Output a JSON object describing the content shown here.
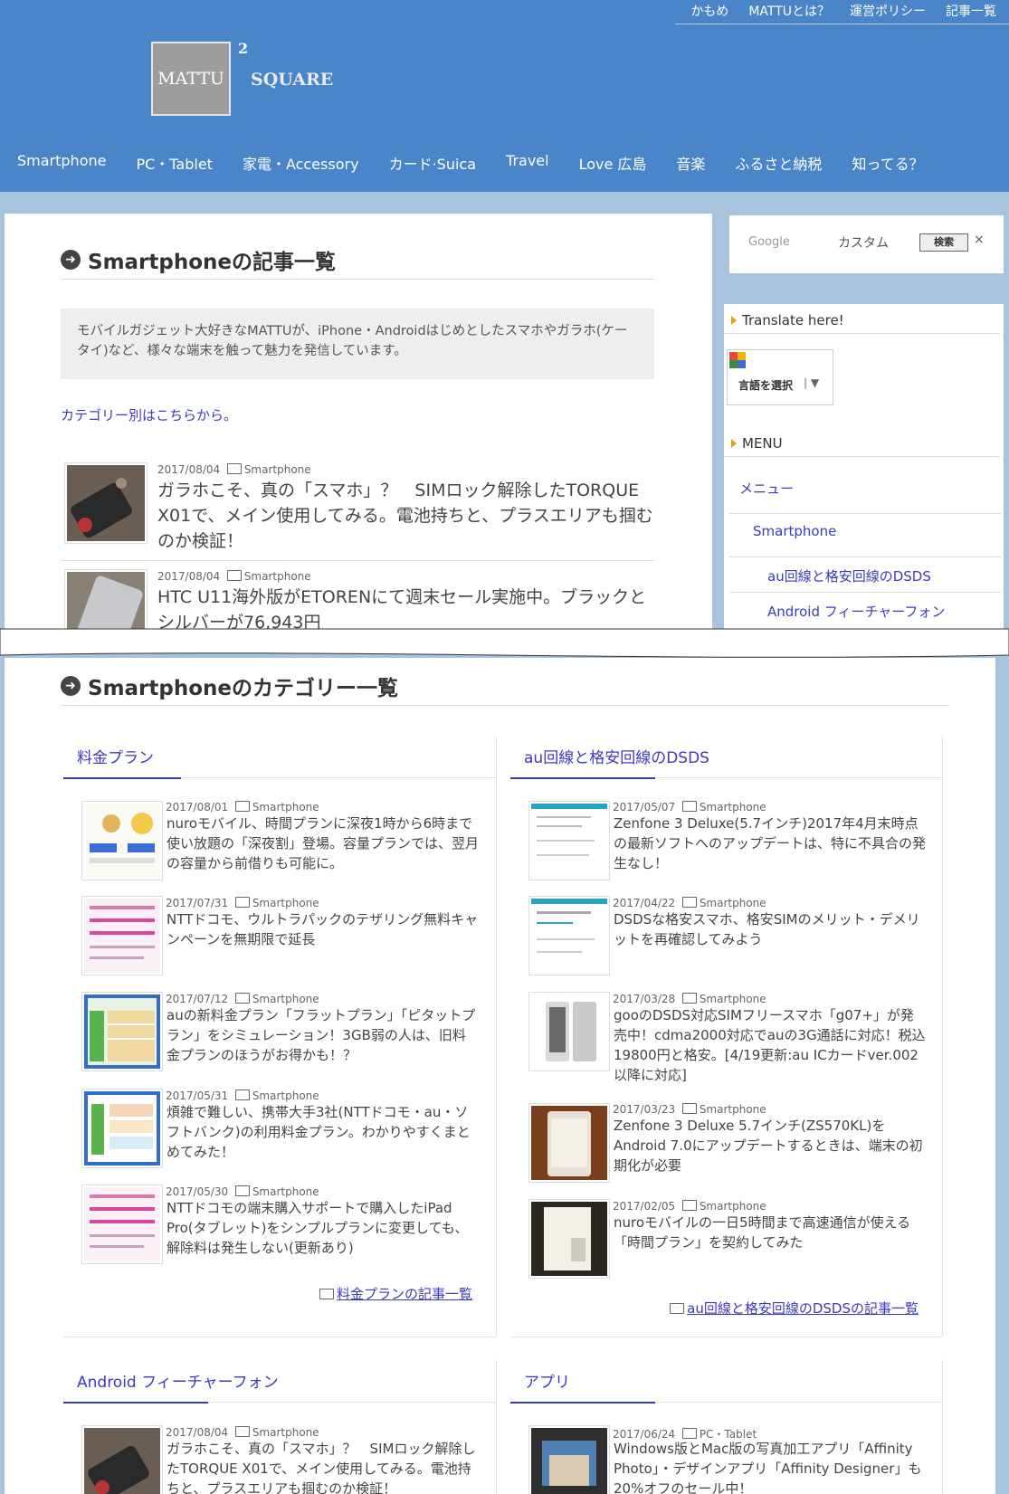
{
  "toplinks": [
    "かもめ",
    "MATTUとは？",
    "運営ポリシー",
    "記事一覧"
  ],
  "logo": {
    "box": "MATTU",
    "sup": "2",
    "text": "SQUARE"
  },
  "nav": [
    "Smartphone",
    "PC・Tablet",
    "家電・Accessory",
    "カード·Suica",
    "Travel",
    "Love 広島",
    "音楽",
    "ふるさと納税",
    "知ってる？"
  ],
  "main": {
    "title": "Smartphoneの記事一覧",
    "description": "モバイルガジェット大好きなMATTUが、iPhone・Androidはじめとしたスマホやガラホ(ケータイ)など、様々な端末を触って魅力を発信しています。",
    "category_link": "カテゴリー別はこちらから。",
    "articles": [
      {
        "date": "2017/08/04",
        "category": "Smartphone",
        "title": "ガラホこそ、真の「スマホ」？　SIMロック解除したTORQUE X01で、メイン使用してみる。電池持ちと、プラスエリアも掴むのか検証！"
      },
      {
        "date": "2017/08/04",
        "category": "Smartphone",
        "title": "HTC U11海外版がETORENにて週末セール実施中。ブラックとシルバーが76,943円"
      }
    ]
  },
  "sidebar": {
    "search_google": "Google",
    "search_placeholder": "カスタム",
    "search_button": "検索",
    "search_clear": "×",
    "translate_heading": "Translate here!",
    "translate_select": "言語を選択",
    "menu_heading": "MENU",
    "menu_items": [
      "メニュー",
      "Smartphone",
      "au回線と格安回線のDSDS",
      "Android フィーチャーフォン"
    ]
  },
  "categories": {
    "title": "Smartphoneのカテゴリー一覧",
    "columns": [
      {
        "name": "料金プラン",
        "items": [
          {
            "date": "2017/08/01",
            "category": "Smartphone",
            "title": "nuroモバイル、時間プランに深夜1時から6時まで使い放題の「深夜割」登場。容量プランでは、翌月の容量から前借りも可能に。"
          },
          {
            "date": "2017/07/31",
            "category": "Smartphone",
            "title": "NTTドコモ、ウルトラパックのテザリング無料キャンペーンを無期限で延長"
          },
          {
            "date": "2017/07/12",
            "category": "Smartphone",
            "title": "auの新料金プラン「フラットプラン」「ピタットプラン」をシミュレーション！3GB弱の人は、旧料金プランのほうがお得かも！？"
          },
          {
            "date": "2017/05/31",
            "category": "Smartphone",
            "title": "煩雑で難しい、携帯大手3社(NTTドコモ・au・ソフトバンク)の利用料金プラン。わかりやすくまとめてみた！"
          },
          {
            "date": "2017/05/30",
            "category": "Smartphone",
            "title": "NTTドコモの端末購入サポートで購入したiPad Pro(タブレット)をシンプルプランに変更しても、解除料は発生しない(更新あり)"
          }
        ],
        "more": "料金プランの記事一覧"
      },
      {
        "name": "au回線と格安回線のDSDS",
        "items": [
          {
            "date": "2017/05/07",
            "category": "Smartphone",
            "title": "Zenfone 3 Deluxe(5.7インチ)2017年4月末時点の最新ソフトへのアップデートは、特に不具合の発生なし！"
          },
          {
            "date": "2017/04/22",
            "category": "Smartphone",
            "title": "DSDSな格安スマホ、格安SIMのメリット・デメリットを再確認してみよう"
          },
          {
            "date": "2017/03/28",
            "category": "Smartphone",
            "title": "gooのDSDS対応SIMフリースマホ「g07+」が発売中！cdma2000対応でauの3G通話に対応！税込19800円と格安。[4/19更新:au ICカードver.002以降に対応]"
          },
          {
            "date": "2017/03/23",
            "category": "Smartphone",
            "title": "Zenfone 3 Deluxe 5.7インチ(ZS570KL)をAndroid 7.0にアップデートするときは、端末の初期化が必要"
          },
          {
            "date": "2017/02/05",
            "category": "Smartphone",
            "title": "nuroモバイルの一日5時間まで高速通信が使える「時間プラン」を契約してみた"
          }
        ],
        "more": "au回線と格安回線のDSDSの記事一覧"
      },
      {
        "name": "Android フィーチャーフォン",
        "items": [
          {
            "date": "2017/08/04",
            "category": "Smartphone",
            "title": "ガラホこそ、真の「スマホ」？　SIMロック解除したTORQUE X01で、メイン使用してみる。電池持ちと、プラスエリアも掴むのか検証！"
          }
        ]
      },
      {
        "name": "アプリ",
        "items": [
          {
            "date": "2017/06/24",
            "category": "PC・Tablet",
            "title": "Windows版とMac版の写真加工アプリ「Affinity Photo」・デザインアプリ「Affinity Designer」も20%オフのセール中！"
          }
        ]
      }
    ]
  }
}
